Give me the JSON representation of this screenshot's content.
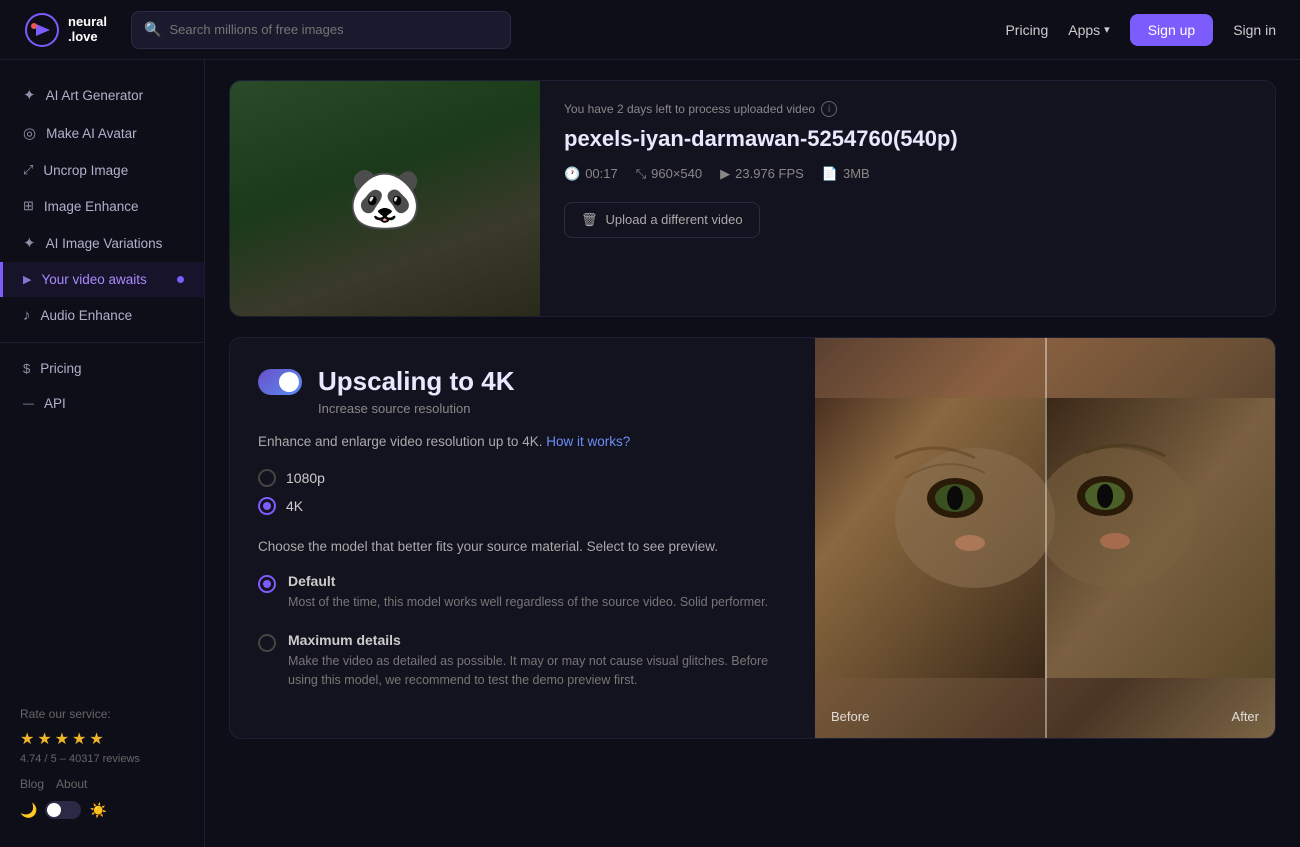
{
  "header": {
    "logo_line1": "neural",
    "logo_line2": ".love",
    "search_placeholder": "Search millions of free images",
    "nav_pricing": "Pricing",
    "nav_apps": "Apps",
    "btn_signup": "Sign up",
    "btn_signin": "Sign in"
  },
  "sidebar": {
    "items": [
      {
        "id": "ai-art-generator",
        "label": "AI Art Generator",
        "icon": "✦"
      },
      {
        "id": "make-ai-avatar",
        "label": "Make AI Avatar",
        "icon": "◎"
      },
      {
        "id": "uncrop-image",
        "label": "Uncrop Image",
        "icon": "⤢"
      },
      {
        "id": "image-enhance",
        "label": "Image Enhance",
        "icon": "⊞"
      },
      {
        "id": "ai-image-variations",
        "label": "AI Image Variations",
        "icon": "✦"
      },
      {
        "id": "your-video-awaits",
        "label": "Your video awaits",
        "icon": "▶",
        "active": true,
        "dot": true
      },
      {
        "id": "audio-enhance",
        "label": "Audio Enhance",
        "icon": "♪"
      }
    ],
    "bottom_items": [
      {
        "id": "pricing",
        "label": "Pricing",
        "icon": "$"
      },
      {
        "id": "api",
        "label": "API",
        "icon": "⟵⟶"
      }
    ],
    "rate_label": "Rate our service:",
    "rating_value": "4.74",
    "rating_max": "5",
    "rating_count": "40317",
    "rating_label": "reviews",
    "footer_links": [
      "Blog",
      "About"
    ],
    "stars": [
      "★",
      "★",
      "★",
      "★",
      "★"
    ]
  },
  "video_card": {
    "notice": "You have 2 days left to process uploaded video",
    "filename": "pexels-iyan-darmawan-5254760(540p)",
    "duration": "00:17",
    "resolution": "960×540",
    "fps": "23.976 FPS",
    "size": "3MB",
    "upload_btn": "Upload a different video"
  },
  "upscale": {
    "title": "Upscaling to 4K",
    "subtitle": "Increase source resolution",
    "description": "Enhance and enlarge video resolution up to 4K.",
    "how_link": "How it works?",
    "resolution_options": [
      {
        "id": "1080p",
        "label": "1080p",
        "selected": false
      },
      {
        "id": "4k",
        "label": "4K",
        "selected": true
      }
    ],
    "model_prompt": "Choose the model that better fits your source material. Select to see preview.",
    "models": [
      {
        "id": "default",
        "name": "Default",
        "description": "Most of the time, this model works well regardless of the source video. Solid performer.",
        "selected": true
      },
      {
        "id": "maximum-details",
        "name": "Maximum details",
        "description": "Make the video as detailed as possible. It may or may not cause visual glitches. Before using this model, we recommend to test the demo preview first.",
        "selected": false
      }
    ],
    "preview_before": "Before",
    "preview_after": "After"
  }
}
